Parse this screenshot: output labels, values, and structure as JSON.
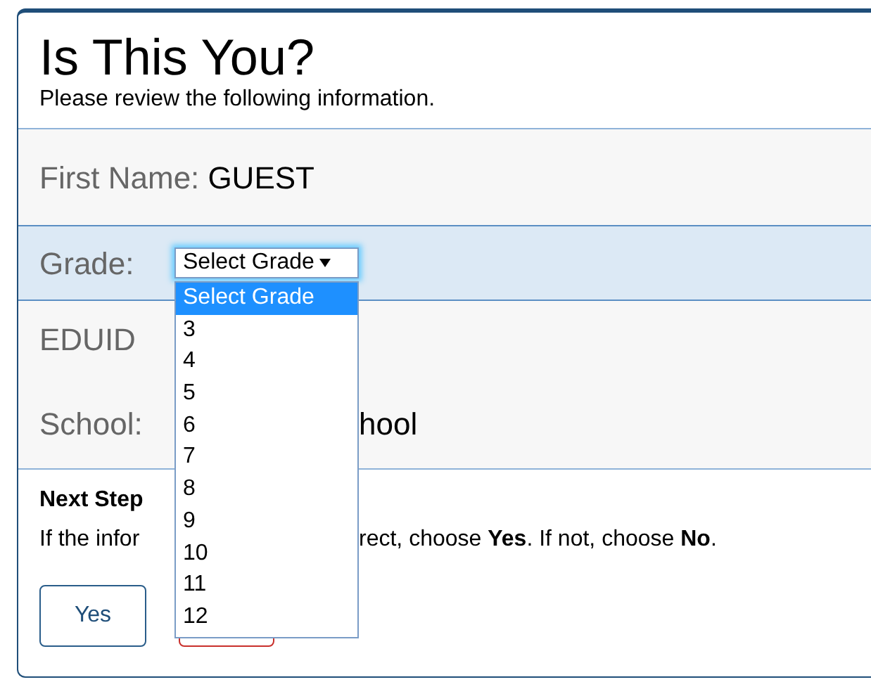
{
  "title": "Is This You?",
  "subtitle": "Please review the following information.",
  "fields": [
    {
      "kind": "text",
      "label": "First Name:",
      "value": "GUEST",
      "focused": false
    },
    {
      "kind": "select",
      "label": "Grade:",
      "value": "Select Grade",
      "focused": true,
      "expanded": true,
      "options": [
        {
          "label": "Select Grade",
          "selected": true
        },
        {
          "label": "3",
          "selected": false
        },
        {
          "label": "4",
          "selected": false
        },
        {
          "label": "5",
          "selected": false
        },
        {
          "label": "6",
          "selected": false
        },
        {
          "label": "7",
          "selected": false
        },
        {
          "label": "8",
          "selected": false
        },
        {
          "label": "9",
          "selected": false
        },
        {
          "label": "10",
          "selected": false
        },
        {
          "label": "11",
          "selected": false
        },
        {
          "label": "12",
          "selected": false
        }
      ]
    },
    {
      "kind": "covered",
      "label": "EDUID",
      "focused": false
    },
    {
      "kind": "covered",
      "label": "School:",
      "value": "hool",
      "focused": false
    }
  ],
  "next_steps": {
    "heading": "Next Step",
    "text_start": "If the infor",
    "text_end": "rect, choose **Yes**. If not, choose **No**."
  },
  "buttons": [
    {
      "kind": "primary",
      "label": "Yes"
    },
    {
      "kind": "danger"
    }
  ]
}
